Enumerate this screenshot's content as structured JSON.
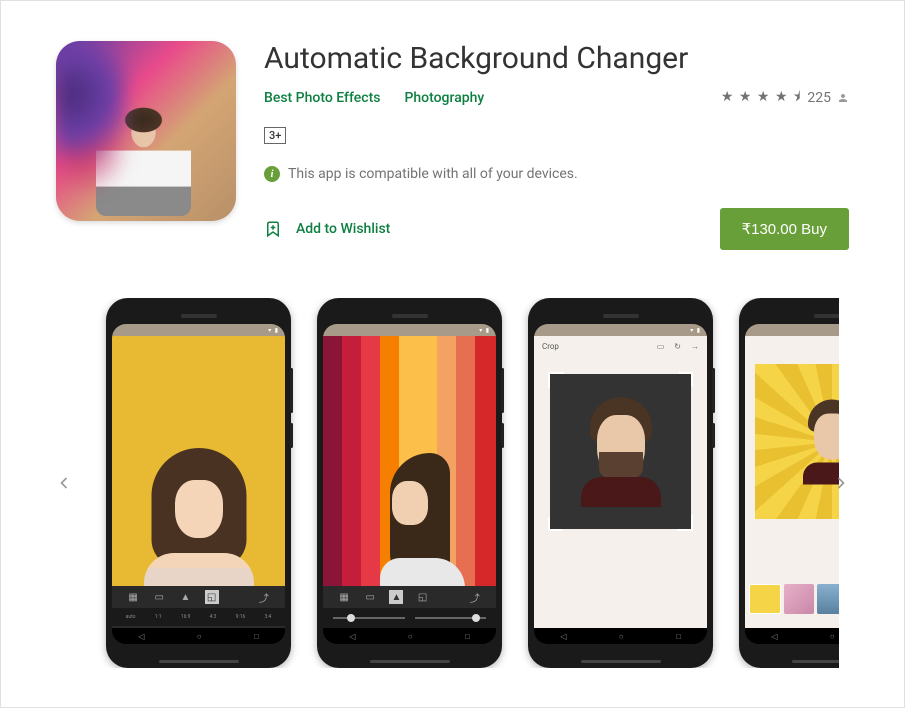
{
  "app": {
    "title": "Automatic Background Changer",
    "developer": "Best Photo Effects",
    "category": "Photography",
    "age_rating": "3+",
    "rating_count": "225",
    "compatibility": "This app is compatible with all of your devices.",
    "wishlist_label": "Add to Wishlist",
    "buy_label": "₹130.00 Buy"
  },
  "screenshots": {
    "s1": {
      "ratios": [
        "auto",
        "1:1",
        "16:9",
        "4:3",
        "9:16",
        "3:4"
      ]
    },
    "s3": {
      "header_title": "Crop"
    }
  }
}
